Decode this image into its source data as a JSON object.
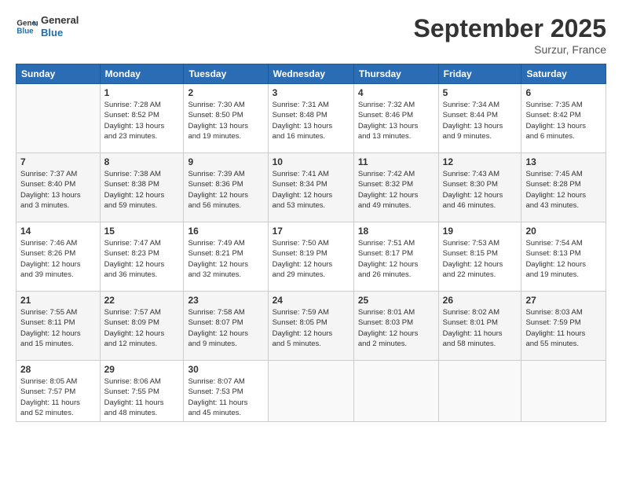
{
  "header": {
    "logo_line1": "General",
    "logo_line2": "Blue",
    "month": "September 2025",
    "location": "Surzur, France"
  },
  "weekdays": [
    "Sunday",
    "Monday",
    "Tuesday",
    "Wednesday",
    "Thursday",
    "Friday",
    "Saturday"
  ],
  "weeks": [
    [
      {
        "day": "",
        "info": ""
      },
      {
        "day": "1",
        "info": "Sunrise: 7:28 AM\nSunset: 8:52 PM\nDaylight: 13 hours\nand 23 minutes."
      },
      {
        "day": "2",
        "info": "Sunrise: 7:30 AM\nSunset: 8:50 PM\nDaylight: 13 hours\nand 19 minutes."
      },
      {
        "day": "3",
        "info": "Sunrise: 7:31 AM\nSunset: 8:48 PM\nDaylight: 13 hours\nand 16 minutes."
      },
      {
        "day": "4",
        "info": "Sunrise: 7:32 AM\nSunset: 8:46 PM\nDaylight: 13 hours\nand 13 minutes."
      },
      {
        "day": "5",
        "info": "Sunrise: 7:34 AM\nSunset: 8:44 PM\nDaylight: 13 hours\nand 9 minutes."
      },
      {
        "day": "6",
        "info": "Sunrise: 7:35 AM\nSunset: 8:42 PM\nDaylight: 13 hours\nand 6 minutes."
      }
    ],
    [
      {
        "day": "7",
        "info": "Sunrise: 7:37 AM\nSunset: 8:40 PM\nDaylight: 13 hours\nand 3 minutes."
      },
      {
        "day": "8",
        "info": "Sunrise: 7:38 AM\nSunset: 8:38 PM\nDaylight: 12 hours\nand 59 minutes."
      },
      {
        "day": "9",
        "info": "Sunrise: 7:39 AM\nSunset: 8:36 PM\nDaylight: 12 hours\nand 56 minutes."
      },
      {
        "day": "10",
        "info": "Sunrise: 7:41 AM\nSunset: 8:34 PM\nDaylight: 12 hours\nand 53 minutes."
      },
      {
        "day": "11",
        "info": "Sunrise: 7:42 AM\nSunset: 8:32 PM\nDaylight: 12 hours\nand 49 minutes."
      },
      {
        "day": "12",
        "info": "Sunrise: 7:43 AM\nSunset: 8:30 PM\nDaylight: 12 hours\nand 46 minutes."
      },
      {
        "day": "13",
        "info": "Sunrise: 7:45 AM\nSunset: 8:28 PM\nDaylight: 12 hours\nand 43 minutes."
      }
    ],
    [
      {
        "day": "14",
        "info": "Sunrise: 7:46 AM\nSunset: 8:26 PM\nDaylight: 12 hours\nand 39 minutes."
      },
      {
        "day": "15",
        "info": "Sunrise: 7:47 AM\nSunset: 8:23 PM\nDaylight: 12 hours\nand 36 minutes."
      },
      {
        "day": "16",
        "info": "Sunrise: 7:49 AM\nSunset: 8:21 PM\nDaylight: 12 hours\nand 32 minutes."
      },
      {
        "day": "17",
        "info": "Sunrise: 7:50 AM\nSunset: 8:19 PM\nDaylight: 12 hours\nand 29 minutes."
      },
      {
        "day": "18",
        "info": "Sunrise: 7:51 AM\nSunset: 8:17 PM\nDaylight: 12 hours\nand 26 minutes."
      },
      {
        "day": "19",
        "info": "Sunrise: 7:53 AM\nSunset: 8:15 PM\nDaylight: 12 hours\nand 22 minutes."
      },
      {
        "day": "20",
        "info": "Sunrise: 7:54 AM\nSunset: 8:13 PM\nDaylight: 12 hours\nand 19 minutes."
      }
    ],
    [
      {
        "day": "21",
        "info": "Sunrise: 7:55 AM\nSunset: 8:11 PM\nDaylight: 12 hours\nand 15 minutes."
      },
      {
        "day": "22",
        "info": "Sunrise: 7:57 AM\nSunset: 8:09 PM\nDaylight: 12 hours\nand 12 minutes."
      },
      {
        "day": "23",
        "info": "Sunrise: 7:58 AM\nSunset: 8:07 PM\nDaylight: 12 hours\nand 9 minutes."
      },
      {
        "day": "24",
        "info": "Sunrise: 7:59 AM\nSunset: 8:05 PM\nDaylight: 12 hours\nand 5 minutes."
      },
      {
        "day": "25",
        "info": "Sunrise: 8:01 AM\nSunset: 8:03 PM\nDaylight: 12 hours\nand 2 minutes."
      },
      {
        "day": "26",
        "info": "Sunrise: 8:02 AM\nSunset: 8:01 PM\nDaylight: 11 hours\nand 58 minutes."
      },
      {
        "day": "27",
        "info": "Sunrise: 8:03 AM\nSunset: 7:59 PM\nDaylight: 11 hours\nand 55 minutes."
      }
    ],
    [
      {
        "day": "28",
        "info": "Sunrise: 8:05 AM\nSunset: 7:57 PM\nDaylight: 11 hours\nand 52 minutes."
      },
      {
        "day": "29",
        "info": "Sunrise: 8:06 AM\nSunset: 7:55 PM\nDaylight: 11 hours\nand 48 minutes."
      },
      {
        "day": "30",
        "info": "Sunrise: 8:07 AM\nSunset: 7:53 PM\nDaylight: 11 hours\nand 45 minutes."
      },
      {
        "day": "",
        "info": ""
      },
      {
        "day": "",
        "info": ""
      },
      {
        "day": "",
        "info": ""
      },
      {
        "day": "",
        "info": ""
      }
    ]
  ]
}
